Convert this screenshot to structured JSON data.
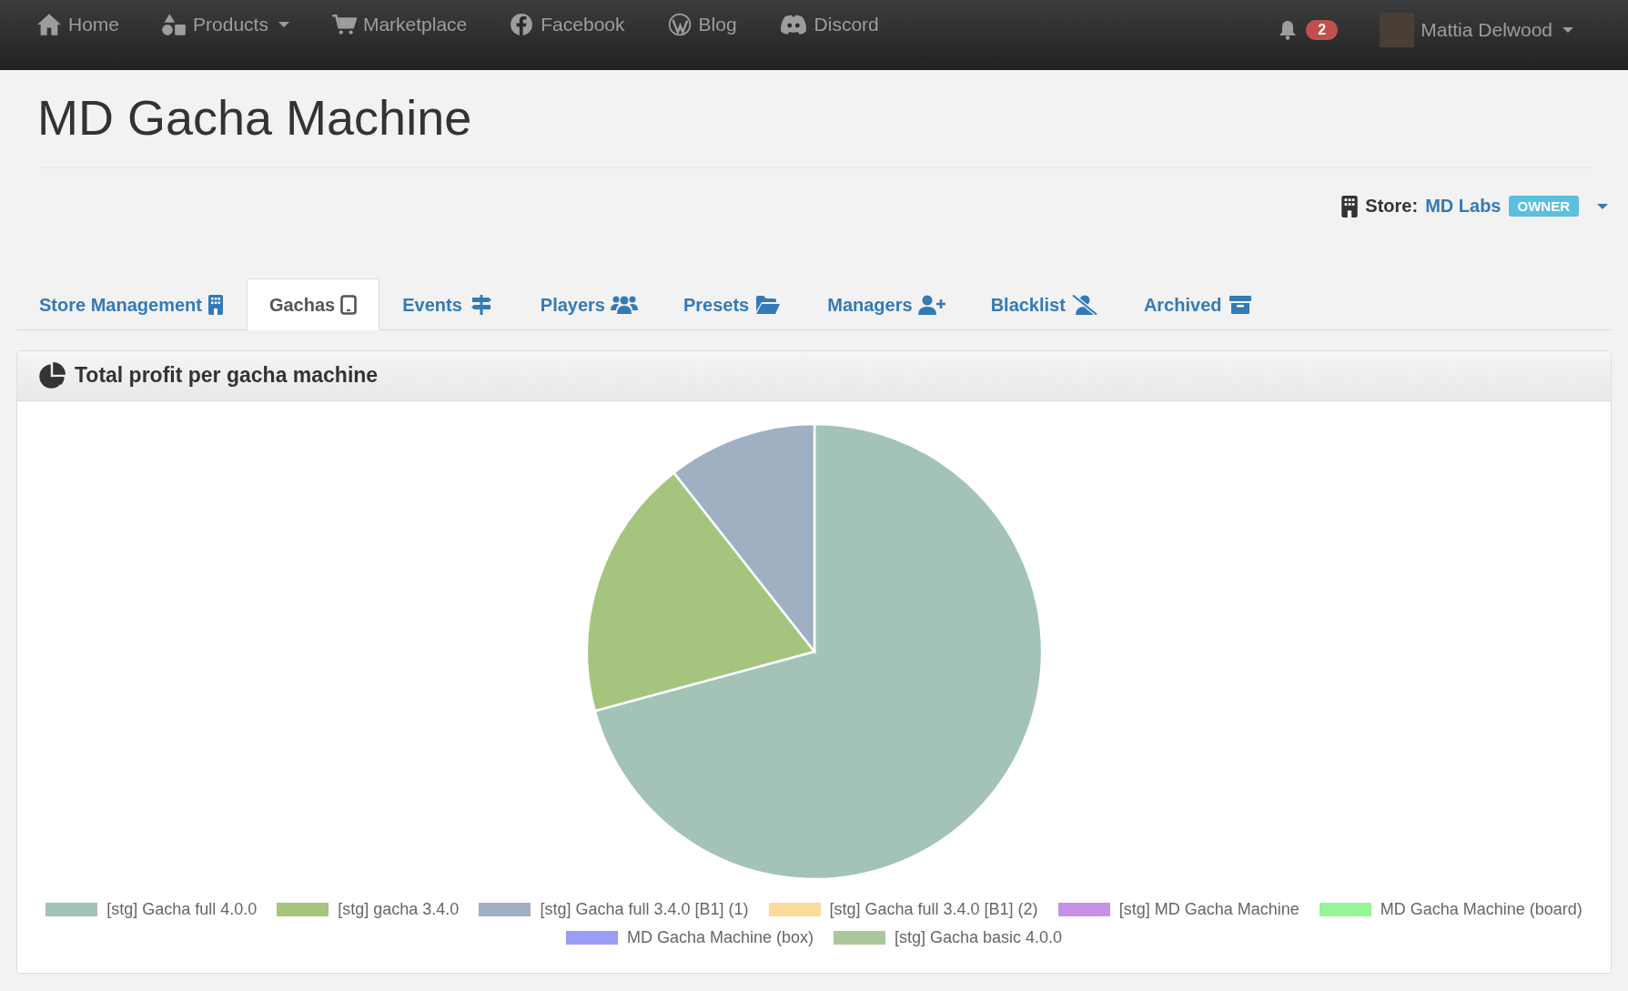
{
  "navbar": {
    "items": [
      {
        "label": "Home",
        "dropdown": false
      },
      {
        "label": "Products",
        "dropdown": true
      },
      {
        "label": "Marketplace",
        "dropdown": false
      },
      {
        "label": "Facebook",
        "dropdown": false
      },
      {
        "label": "Blog",
        "dropdown": false
      },
      {
        "label": "Discord",
        "dropdown": false
      }
    ],
    "notifications": {
      "count": "2"
    },
    "user": {
      "name": "Mattia Delwood"
    }
  },
  "page_title": "MD Gacha Machine",
  "store": {
    "label": "Store:",
    "name": "MD Labs",
    "badge": "OWNER"
  },
  "tabs": [
    {
      "label": "Store Management",
      "selected": false
    },
    {
      "label": "Gachas",
      "selected": true
    },
    {
      "label": "Events",
      "selected": false
    },
    {
      "label": "Players",
      "selected": false
    },
    {
      "label": "Presets",
      "selected": false
    },
    {
      "label": "Managers",
      "selected": false
    },
    {
      "label": "Blacklist",
      "selected": false
    },
    {
      "label": "Archived",
      "selected": false
    }
  ],
  "panel": {
    "title": "Total profit per gacha machine",
    "legend": [
      {
        "label": "[stg] Gacha full 4.0.0",
        "color": "#a2c3b6"
      },
      {
        "label": "[stg] gacha 3.4.0",
        "color": "#a5c57f"
      },
      {
        "label": "[stg] Gacha full 3.4.0 [B1] (1)",
        "color": "#a0b0c3"
      },
      {
        "label": "[stg] Gacha full 3.4.0 [B1] (2)",
        "color": "#fddb9a"
      },
      {
        "label": "[stg] MD Gacha Machine",
        "color": "#c792e6"
      },
      {
        "label": "MD Gacha Machine (board)",
        "color": "#96f596"
      },
      {
        "label": "MD Gacha Machine (box)",
        "color": "#9b9cf5"
      },
      {
        "label": "[stg] Gacha basic 4.0.0",
        "color": "#aac89c"
      }
    ]
  }
}
